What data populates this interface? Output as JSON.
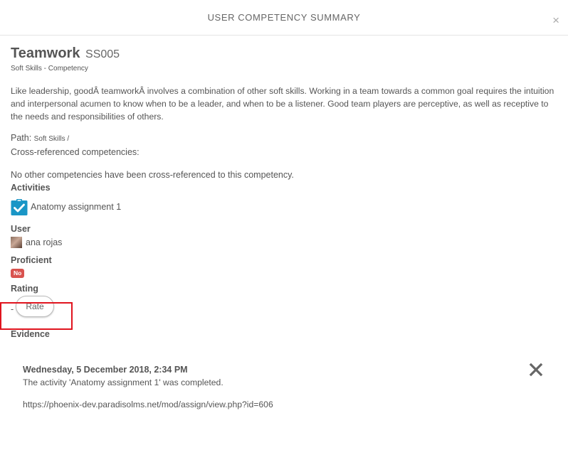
{
  "modal": {
    "title": "USER COMPETENCY SUMMARY",
    "close_icon": "close-icon",
    "close_glyph": "×"
  },
  "competency": {
    "name": "Teamwork",
    "idnumber": "SS005",
    "framework": "Soft Skills - Competency",
    "description": "Like leadership, goodÂ teamworkÂ involves a combination of other soft skills. Working in a team towards a common goal requires the intuition and interpersonal acumen to know when to be a leader, and when to be a listener. Good team players are perceptive, as well as receptive to the needs and responsibilities of others.",
    "path_label": "Path:",
    "path_value": "Soft Skills /",
    "xref_label": "Cross-referenced competencies:",
    "xref_none": "No other competencies have been cross-referenced to this competency."
  },
  "activities": {
    "heading": "Activities",
    "items": [
      {
        "icon": "assignment-icon",
        "label": "Anatomy assignment 1"
      }
    ]
  },
  "user": {
    "heading": "User",
    "name": "ana rojas",
    "avatar": "avatar"
  },
  "proficient": {
    "heading": "Proficient",
    "value": "No",
    "color": "#d9534f"
  },
  "rating": {
    "heading": "Rating",
    "value": "-",
    "rate_button": "Rate"
  },
  "evidence": {
    "heading": "Evidence",
    "items": [
      {
        "date": "Wednesday, 5 December 2018, 2:34 PM",
        "description": "The activity 'Anatomy assignment 1' was completed.",
        "url": "https://phoenix-dev.paradisolms.net/mod/assign/view.php?id=606",
        "delete_icon": "delete-icon"
      }
    ]
  },
  "colors": {
    "accent_blue": "#1a96c6",
    "badge_red": "#d9534f",
    "highlight_red": "#e0141e"
  }
}
